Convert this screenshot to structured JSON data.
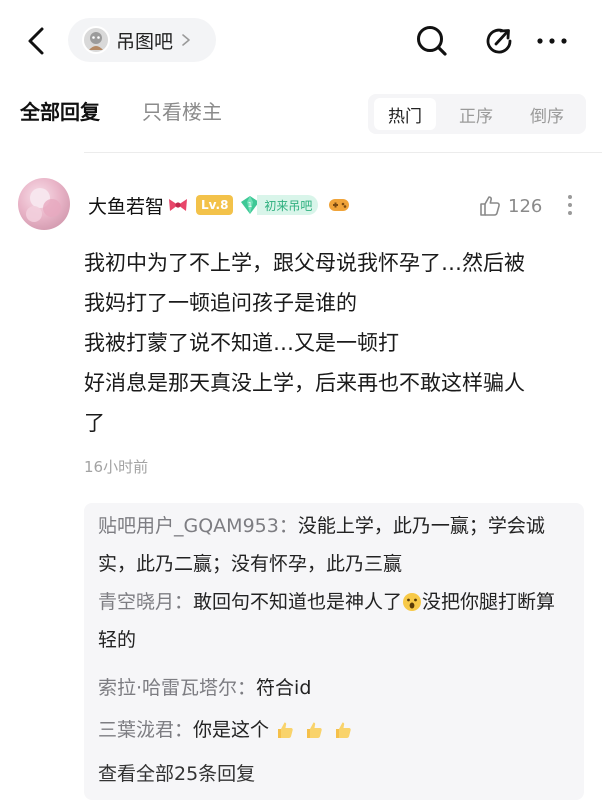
{
  "topbar": {
    "forum_name": "吊图吧"
  },
  "tabs": {
    "all_replies": "全部回复",
    "only_op": "只看楼主",
    "sort": [
      "热门",
      "正序",
      "倒序"
    ],
    "active_sort": "热门"
  },
  "post": {
    "username": "大鱼若智",
    "level": "Lv.8",
    "badge": "初来吊吧",
    "like_count": "126",
    "lines": [
      "我初中为了不上学，跟父母说我怀孕了…然后被",
      "我妈打了一顿追问孩子是谁的",
      "我被打蒙了说不知道…又是一顿打",
      "好消息是那天真没上学，后来再也不敢这样骗人",
      "了"
    ],
    "time": "16小时前"
  },
  "replies": [
    {
      "name": "贴吧用户_GQAM953：",
      "text": "没能上学，此乃一赢；学会诚实，此乃二赢；没有怀孕，此乃三赢"
    },
    {
      "name": "青空晓月：",
      "text_before": "敢回句不知道也是神人了",
      "text_after": "没把你腿打断算轻的"
    },
    {
      "name": "索拉·哈雷瓦塔尔：",
      "text": "符合id"
    },
    {
      "name": "三葉泷君：",
      "text": "你是这个"
    }
  ],
  "view_all": "查看全部25条回复",
  "icons": {
    "back": "back-arrow-icon",
    "search": "search-icon",
    "share": "share-icon",
    "more": "more-dots-icon",
    "like": "thumbs-up-icon"
  },
  "colors": {
    "level_badge": "#f3c24a",
    "newbie_badge_text": "#2fb07f",
    "reply_name": "#7d7d82"
  }
}
